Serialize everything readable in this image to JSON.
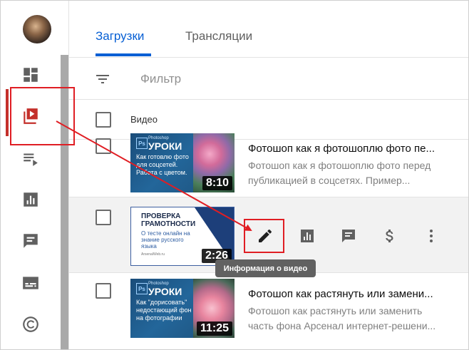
{
  "tabs": [
    {
      "label": "Загрузки",
      "active": true
    },
    {
      "label": "Трансляции",
      "active": false
    }
  ],
  "filter": {
    "placeholder": "Фильтр"
  },
  "table": {
    "header_label": "Видео"
  },
  "sidebar": {
    "items": [
      {
        "icon": "dashboard-icon"
      },
      {
        "icon": "videos-icon",
        "active": true
      },
      {
        "icon": "playlists-icon"
      },
      {
        "icon": "analytics-icon"
      },
      {
        "icon": "comments-icon"
      },
      {
        "icon": "subtitles-icon"
      },
      {
        "icon": "copyright-icon"
      }
    ]
  },
  "videos": [
    {
      "title": "Фотошоп как я фотошоплю фото пе...",
      "description": "Фотошоп как я фотошоплю фото перед публикацией в соцсетях. Пример...",
      "duration": "8:10",
      "thumb": {
        "ps": "Ps",
        "small": "Photoshop",
        "big": "УРОКИ",
        "sub": "Как готовлю фото для соцсетей. Работа с цветом."
      }
    },
    {
      "title": "",
      "description": "",
      "duration": "2:26",
      "thumb": {
        "line1": "ПРОВЕРКА",
        "line2": "ГРАМОТНОСТИ",
        "sub": "О тесте онлайн на знание русского языка",
        "url": "ArsenalWeb.ru"
      }
    },
    {
      "title": "Фотошоп как растянуть или замени...",
      "description": "Фотошоп как растянуть или заменить часть фона Арсенал интернет-решени...",
      "duration": "11:25",
      "thumb": {
        "ps": "Ps",
        "small": "Photoshop",
        "big": "УРОКИ",
        "sub": "Как \"дорисовать\" недостающий фон на фотографии"
      }
    }
  ],
  "tooltip": {
    "text": "Информация о видео"
  },
  "actions": [
    {
      "icon": "pencil-icon",
      "label": "edit"
    },
    {
      "icon": "analytics-icon"
    },
    {
      "icon": "comments-icon"
    },
    {
      "icon": "dollar-icon"
    },
    {
      "icon": "more-vert-icon"
    }
  ],
  "colors": {
    "accent": "#065fd4",
    "annotation_red": "#e01e24",
    "active_bar": "#c4302b"
  }
}
